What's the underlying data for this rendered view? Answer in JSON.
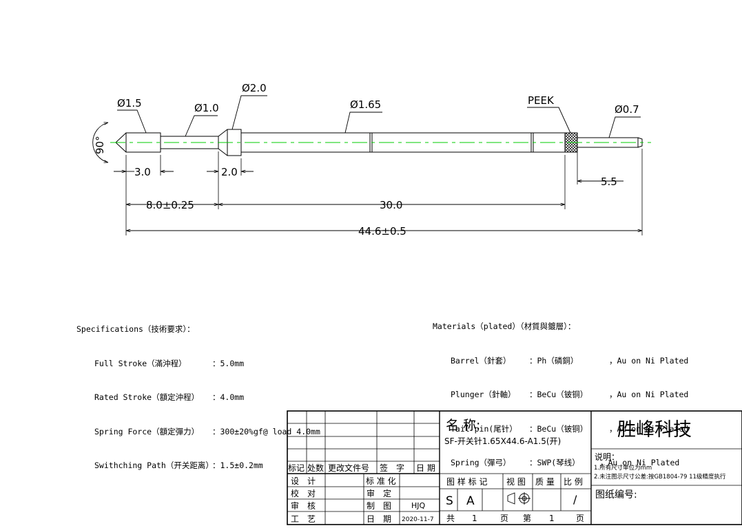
{
  "dimensions": {
    "d_tip": "Ø1.5",
    "d_neck": "Ø1.0",
    "d_collar": "Ø2.0",
    "d_barrel": "Ø1.65",
    "peek": "PEEK",
    "d_tail": "Ø0.7",
    "angle": "90°",
    "len_tip": "3.0",
    "len_collar": "2.0",
    "len_tail": "5.5",
    "len_plunger": "8.0±0.25",
    "len_barrel": "30.0",
    "len_total": "44.6±0.5"
  },
  "specifications": {
    "title": "Specifications（技術要求）：",
    "rows": [
      {
        "label": "Full Stroke（滿沖程）",
        "value": "：5.0mm"
      },
      {
        "label": "Rated Stroke（額定沖程）",
        "value": "：4.0mm"
      },
      {
        "label": "Spring Force（額定彈力）",
        "value": "：300±20%gf@ load 4.0mm"
      },
      {
        "label": "Swithching Path（开关距离）",
        "value": "：1.5±0.2mm"
      }
    ]
  },
  "materials": {
    "title": "Materials（plated）（材質與鍍層）：",
    "rows": [
      {
        "part": "Barrel（針套）",
        "material": "：Ph（磷銅）",
        "plating": "，Au on Ni Plated"
      },
      {
        "part": "Plunger（針軸）",
        "material": "：BeCu（铍铜）",
        "plating": "，Au on Ni Plated"
      },
      {
        "part": "Tail pin(尾针）",
        "material": "：BeCu（铍铜）",
        "plating": "，Au on Ni Plated"
      },
      {
        "part": "Spring（彈弓）",
        "material": "：SWP(琴线）",
        "plating": "，Au on Ni Plated"
      }
    ]
  },
  "title_block": {
    "rev_headers": [
      "标记",
      "处数",
      "更改文件号",
      "签　字",
      "日 期"
    ],
    "design": "设　计",
    "check": "校　对",
    "review": "审　核",
    "process": "工　艺",
    "standard": "标 准 化",
    "approve": "审　定",
    "draw": "制　图",
    "drawer": "HJQ",
    "date_label": "日　期",
    "date": "2020-11-7",
    "name_label": "名 称:",
    "part_name": "SF-开关针1.65X44.6-A1.5(开)",
    "company": "胜峰科技",
    "notes_title": "说明：",
    "note1": "1.所有尺寸单位为mm",
    "note2": "2.未注图示尺寸公差:按GB1804-79 11级精度执行",
    "pattern_mark": "图 样 标 记",
    "view": "视 图",
    "mass": "质 量",
    "scale": "比 例",
    "mark_s": "S",
    "mark_a": "A",
    "scale_val": "/",
    "drawing_no": "图纸编号:",
    "total_label": "共",
    "total_val": "1",
    "page_label": "页",
    "sheet_label": "第",
    "sheet_val": "1",
    "sheet_page": "页"
  },
  "colors": {
    "line": "#000000",
    "centerline": "#00cc00"
  }
}
